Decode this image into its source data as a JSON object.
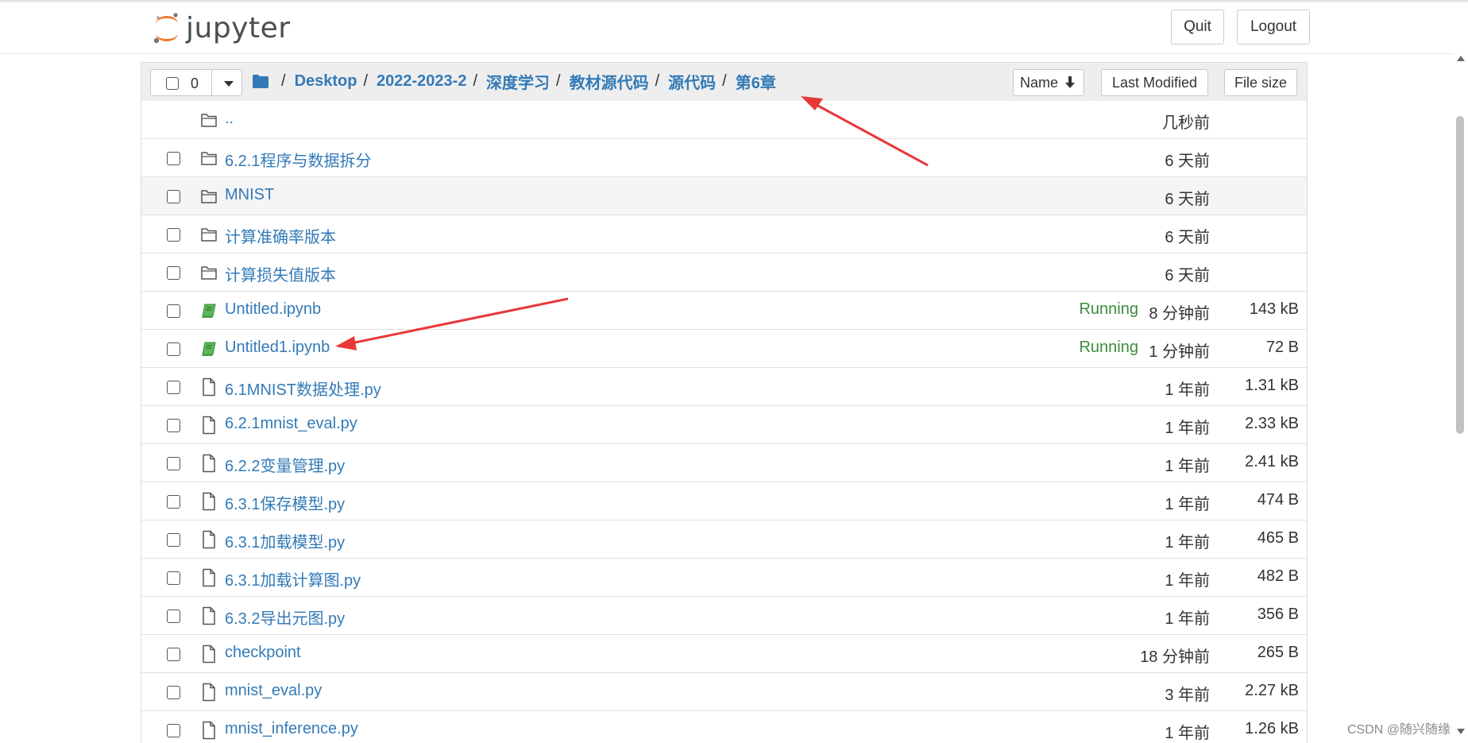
{
  "header": {
    "logo_text": "jupyter",
    "quit_label": "Quit",
    "logout_label": "Logout"
  },
  "list_header": {
    "selected_count": "0",
    "breadcrumbs": [
      "Desktop",
      "2022-2023-2",
      "深度学习",
      "教材源代码",
      "源代码",
      "第6章"
    ],
    "separator": "/",
    "sort_name_label": "Name",
    "sort_modified_label": "Last Modified",
    "sort_size_label": "File size"
  },
  "rows": [
    {
      "type": "parent",
      "name": "..",
      "running": "",
      "modified": "几秒前",
      "size": ""
    },
    {
      "type": "folder",
      "name": "6.2.1程序与数据拆分",
      "running": "",
      "modified": "6 天前",
      "size": ""
    },
    {
      "type": "folder",
      "name": "MNIST",
      "running": "",
      "modified": "6 天前",
      "size": ""
    },
    {
      "type": "folder",
      "name": "计算准确率版本",
      "running": "",
      "modified": "6 天前",
      "size": ""
    },
    {
      "type": "folder",
      "name": "计算损失值版本",
      "running": "",
      "modified": "6 天前",
      "size": ""
    },
    {
      "type": "notebook",
      "name": "Untitled.ipynb",
      "running": "Running",
      "modified": "8 分钟前",
      "size": "143 kB"
    },
    {
      "type": "notebook",
      "name": "Untitled1.ipynb",
      "running": "Running",
      "modified": "1 分钟前",
      "size": "72 B"
    },
    {
      "type": "file",
      "name": "6.1MNIST数据处理.py",
      "running": "",
      "modified": "1 年前",
      "size": "1.31 kB"
    },
    {
      "type": "file",
      "name": "6.2.1mnist_eval.py",
      "running": "",
      "modified": "1 年前",
      "size": "2.33 kB"
    },
    {
      "type": "file",
      "name": "6.2.2变量管理.py",
      "running": "",
      "modified": "1 年前",
      "size": "2.41 kB"
    },
    {
      "type": "file",
      "name": "6.3.1保存模型.py",
      "running": "",
      "modified": "1 年前",
      "size": "474 B"
    },
    {
      "type": "file",
      "name": "6.3.1加载模型.py",
      "running": "",
      "modified": "1 年前",
      "size": "465 B"
    },
    {
      "type": "file",
      "name": "6.3.1加载计算图.py",
      "running": "",
      "modified": "1 年前",
      "size": "482 B"
    },
    {
      "type": "file",
      "name": "6.3.2导出元图.py",
      "running": "",
      "modified": "1 年前",
      "size": "356 B"
    },
    {
      "type": "file",
      "name": "checkpoint",
      "running": "",
      "modified": "18 分钟前",
      "size": "265 B"
    },
    {
      "type": "file",
      "name": "mnist_eval.py",
      "running": "",
      "modified": "3 年前",
      "size": "2.27 kB"
    },
    {
      "type": "file",
      "name": "mnist_inference.py",
      "running": "",
      "modified": "1 年前",
      "size": "1.26 kB"
    }
  ],
  "watermark": "CSDN @随兴随缘",
  "colors": {
    "link": "#337ab7",
    "running": "#3c8b3c",
    "annotation_arrow": "#e8383a",
    "logo_orange": "#f37726"
  }
}
